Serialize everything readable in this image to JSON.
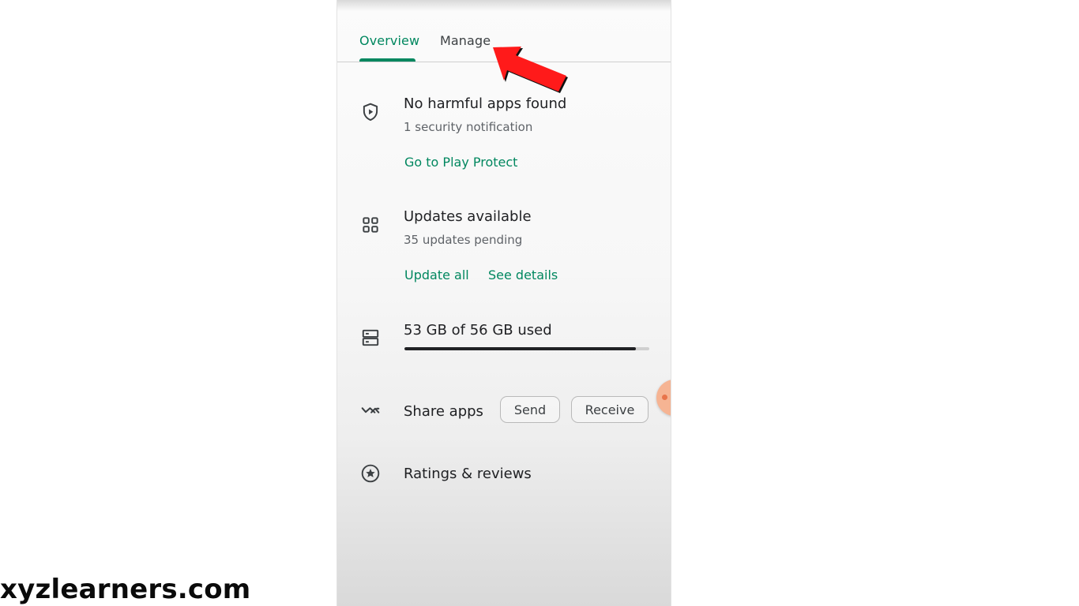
{
  "tabs": {
    "overview": "Overview",
    "manage": "Manage"
  },
  "sections": {
    "protect": {
      "icon": "shield-play-icon",
      "title": "No harmful apps found",
      "subtitle": "1 security notification",
      "action": "Go to Play Protect"
    },
    "updates": {
      "icon": "apps-grid-icon",
      "title": "Updates available",
      "subtitle": "35 updates pending",
      "action_update_all": "Update all",
      "action_see_details": "See details"
    },
    "storage": {
      "icon": "storage-icon",
      "title": "53 GB of 56 GB used",
      "used_fraction": 0.946
    },
    "share": {
      "icon": "share-apps-icon",
      "title": "Share apps",
      "send": "Send",
      "receive": "Receive"
    },
    "ratings": {
      "icon": "star-circle-icon",
      "title": "Ratings & reviews"
    }
  },
  "overlay": {
    "arrow_icon": "red-arrow-pointer-icon",
    "watermark": "xyzlearners.com"
  },
  "colors": {
    "accent": "#01875f",
    "text_primary": "#202124",
    "text_secondary": "#5f6368",
    "arrow": "#ff1a1a"
  }
}
